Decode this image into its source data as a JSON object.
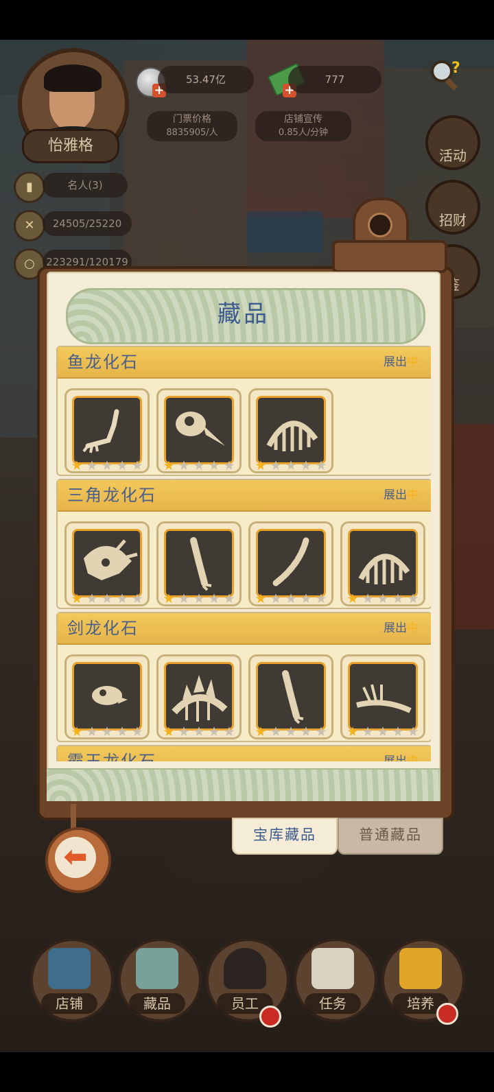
{
  "player": {
    "name": "怡雅格",
    "title": "名人(3)",
    "bones": "24505/25220",
    "research": "223291/120179"
  },
  "resources": {
    "silver": "53.47亿",
    "cash": "777",
    "ticket_price_label": "门票价格",
    "ticket_price_value": "8835905/人",
    "promo_label": "店铺宣传",
    "promo_value": "0.85人/分钟"
  },
  "side_buttons": [
    "活动",
    "招财",
    "鉴"
  ],
  "panel": {
    "title": "藏品",
    "categories": [
      {
        "name": "鱼龙化石",
        "status_prefix": "展出",
        "status_suffix": "中",
        "items": [
          {
            "icon": "limb-fossil-icon",
            "stars": 1
          },
          {
            "icon": "skull-beak-fossil-icon",
            "stars": 1
          },
          {
            "icon": "ribcage-fossil-icon",
            "stars": 1
          }
        ]
      },
      {
        "name": "三角龙化石",
        "status_prefix": "展出",
        "status_suffix": "中",
        "items": [
          {
            "icon": "triceratops-skull-icon",
            "stars": 1
          },
          {
            "icon": "leg-bone-icon",
            "stars": 1
          },
          {
            "icon": "tail-bone-icon",
            "stars": 1
          },
          {
            "icon": "ribcage-fossil-icon",
            "stars": 1
          }
        ]
      },
      {
        "name": "剑龙化石",
        "status_prefix": "展出",
        "status_suffix": "中",
        "items": [
          {
            "icon": "small-skull-icon",
            "stars": 1
          },
          {
            "icon": "stegosaurus-plates-icon",
            "stars": 1
          },
          {
            "icon": "leg-bone-icon",
            "stars": 1
          },
          {
            "icon": "spiked-tail-icon",
            "stars": 1
          }
        ]
      },
      {
        "name": "霸王龙化石",
        "status_prefix": "展出",
        "status_suffix": "中",
        "items": []
      }
    ]
  },
  "tabs": {
    "vault": "宝库藏品",
    "normal": "普通藏品"
  },
  "nav": {
    "shop": "店铺",
    "collection": "藏品",
    "staff": "员工",
    "tasks": "任务",
    "train": "培养"
  },
  "colors": {
    "accent": "#f4b21c",
    "title_blue": "#3d5a8e",
    "badge_red": "#c82a24"
  }
}
